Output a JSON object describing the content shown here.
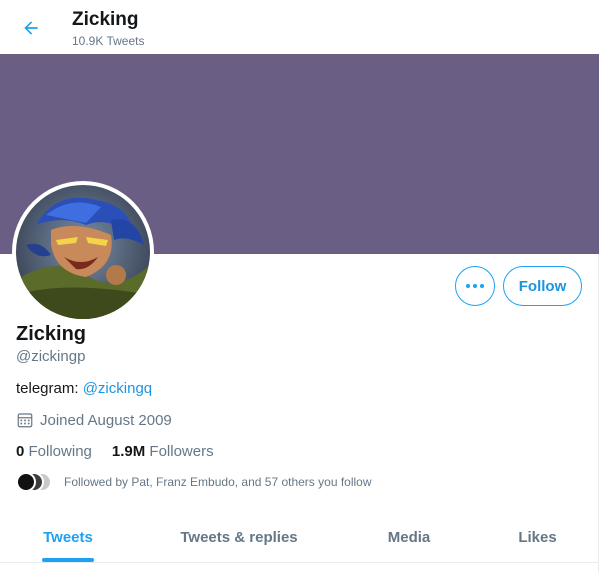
{
  "header": {
    "title": "Zicking",
    "tweet_count": "10.9K Tweets"
  },
  "colors": {
    "accent": "#1da1f2",
    "banner": "#6b5e85",
    "muted_text": "#657786"
  },
  "profile": {
    "name": "Zicking",
    "handle": "@zickingp",
    "bio_prefix": "telegram: ",
    "bio_link": "@zickingq",
    "joined": "Joined August 2009",
    "following_count": "0",
    "following_label": "Following",
    "followers_count": "1.9M",
    "followers_label": "Followers",
    "followed_by": "Followed by Pat, Franz Embudo, and 57 others you follow"
  },
  "actions": {
    "follow_label": "Follow",
    "more_icon": "more-horizontal-icon"
  },
  "tabs": [
    {
      "label": "Tweets",
      "active": true
    },
    {
      "label": "Tweets & replies",
      "active": false
    },
    {
      "label": "Media",
      "active": false
    },
    {
      "label": "Likes",
      "active": false
    }
  ]
}
